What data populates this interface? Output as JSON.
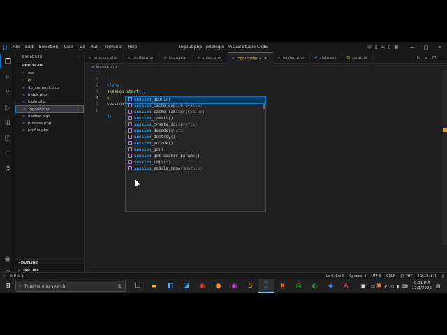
{
  "window": {
    "title": "logout.php - phplogin - Visual Studio Code",
    "menu": [
      "File",
      "Edit",
      "Selection",
      "View",
      "Go",
      "Run",
      "Terminal",
      "Help"
    ]
  },
  "sidebar": {
    "header": "EXPLORER",
    "folder": "PHPLOGIN",
    "items": [
      {
        "label": "css",
        "type": "folder"
      },
      {
        "label": "js",
        "type": "folder"
      },
      {
        "label": "db_connect.php",
        "type": "php"
      },
      {
        "label": "index.php",
        "type": "php"
      },
      {
        "label": "login.php",
        "type": "php"
      },
      {
        "label": "logout.php",
        "type": "php",
        "active": true
      },
      {
        "label": "navbar.php",
        "type": "php"
      },
      {
        "label": "process.php",
        "type": "php"
      },
      {
        "label": "profile.php",
        "type": "php"
      }
    ],
    "outline": "OUTLINE",
    "timeline": "TIMELINE"
  },
  "tabs": [
    {
      "label": "process.php",
      "type": "php"
    },
    {
      "label": "profile.php",
      "type": "php"
    },
    {
      "label": "login.php",
      "type": "php"
    },
    {
      "label": "index.php",
      "type": "php"
    },
    {
      "label": "logout.php 1",
      "type": "php",
      "active": true
    },
    {
      "label": "navbar.php",
      "type": "php"
    },
    {
      "label": "style.css",
      "type": "css"
    },
    {
      "label": "script.js",
      "type": "js"
    }
  ],
  "breadcrumb": "logout.php",
  "editor": {
    "lines": [
      {
        "n": "1",
        "text": "<?php"
      },
      {
        "n": "2",
        "fn": "session_start",
        "rest": "();"
      },
      {
        "n": "3",
        "text": ""
      },
      {
        "n": "4",
        "text": "session"
      },
      {
        "n": "5",
        "text": ""
      },
      {
        "n": "6",
        "text": "?>"
      }
    ]
  },
  "suggestions": [
    {
      "match": "session",
      "rest": "_abort()",
      "sig": ""
    },
    {
      "match": "session",
      "rest": "_cache_expire(",
      "sig": "$value)"
    },
    {
      "match": "session",
      "rest": "_cache_limiter(",
      "sig": "$value)"
    },
    {
      "match": "session",
      "rest": "_commit()",
      "sig": ""
    },
    {
      "match": "session",
      "rest": "_create_id(",
      "sig": "$prefix)"
    },
    {
      "match": "session",
      "rest": "_decode(",
      "sig": "$data)"
    },
    {
      "match": "session",
      "rest": "_destroy()",
      "sig": ""
    },
    {
      "match": "session",
      "rest": "_encode()",
      "sig": ""
    },
    {
      "match": "session",
      "rest": "_gc()",
      "sig": ""
    },
    {
      "match": "session",
      "rest": "_get_cookie_params()",
      "sig": ""
    },
    {
      "match": "session",
      "rest": "_id(",
      "sig": "$id)"
    },
    {
      "match": "session",
      "rest": "_module_name(",
      "sig": "$module)"
    }
  ],
  "status": {
    "errors": "⊗ 0",
    "warnings": "⚠ 1",
    "position": "Ln 4, Col 8",
    "spaces": "Spaces: 4",
    "encoding": "UTF-8",
    "eol": "CRLF",
    "language": "PHP",
    "version": "8.2.12: 8.4"
  },
  "taskbar": {
    "search_placeholder": "Type here to search",
    "time": "9:01 PM",
    "date": "12/1/2025"
  },
  "colors": {
    "accent": "#0078d4",
    "keyword": "#569cd6",
    "function": "#dcdcaa",
    "match": "#2aaaff"
  }
}
